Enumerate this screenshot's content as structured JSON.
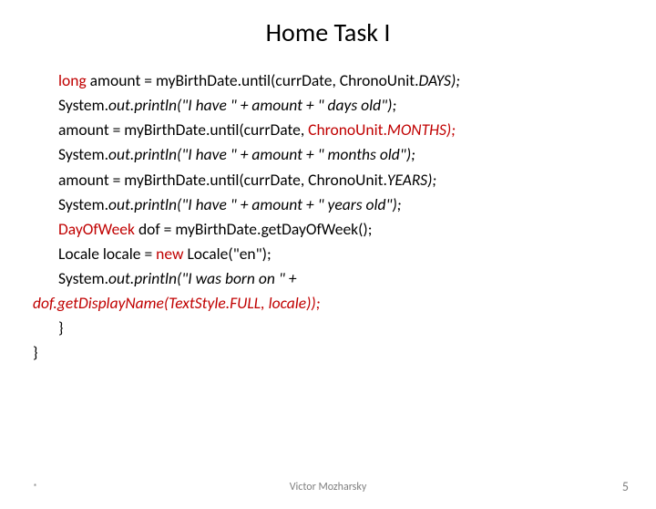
{
  "title": "Home Task I",
  "lines": [
    {
      "indent": true,
      "spans": [
        {
          "t": "long ",
          "c": "red"
        },
        {
          "t": "amount = myBirthDate.until(currDate, ",
          "c": "black"
        },
        {
          "t": "ChronoUnit.",
          "c": "black"
        },
        {
          "t": "DAYS);",
          "c": "black",
          "i": true
        }
      ]
    },
    {
      "indent": true,
      "spans": [
        {
          "t": "System.",
          "c": "black"
        },
        {
          "t": "out.println(\"I have \" + amount + \" days old\");",
          "c": "black",
          "i": true
        }
      ]
    },
    {
      "indent": true,
      "spans": [
        {
          "t": "amount = myBirthDate.until(currDate, ",
          "c": "black"
        },
        {
          "t": "ChronoUnit.",
          "c": "red"
        },
        {
          "t": "MONTHS);",
          "c": "red",
          "i": true
        }
      ]
    },
    {
      "indent": true,
      "spans": [
        {
          "t": "System.",
          "c": "black"
        },
        {
          "t": "out.println(\"I have \" + amount + \" months old\");",
          "c": "black",
          "i": true
        }
      ]
    },
    {
      "indent": true,
      "spans": [
        {
          "t": "amount = myBirthDate.until(currDate, ",
          "c": "black"
        },
        {
          "t": "ChronoUnit.",
          "c": "black"
        },
        {
          "t": "YEARS);",
          "c": "black",
          "i": true
        }
      ]
    },
    {
      "indent": true,
      "spans": [
        {
          "t": "System.",
          "c": "black"
        },
        {
          "t": "out.println(\"I have \" + amount + \" years old\");",
          "c": "black",
          "i": true
        }
      ]
    },
    {
      "indent": true,
      "spans": [
        {
          "t": "DayOfWeek ",
          "c": "red"
        },
        {
          "t": "dof = myBirthDate.getDayOfWeek();",
          "c": "black"
        }
      ]
    },
    {
      "indent": true,
      "spans": [
        {
          "t": "Locale locale = ",
          "c": "black"
        },
        {
          "t": "new ",
          "c": "red"
        },
        {
          "t": "Locale(",
          "c": "black"
        },
        {
          "t": "\"en\");",
          "c": "black"
        }
      ]
    },
    {
      "indent": true,
      "spans": [
        {
          "t": "System.",
          "c": "black"
        },
        {
          "t": "out.println(\"I was born on \" + ",
          "c": "black",
          "i": true
        }
      ]
    },
    {
      "indent": false,
      "spans": [
        {
          "t": "dof.getDisplayName(TextStyle.",
          "c": "red",
          "i": true
        },
        {
          "t": "FULL, locale));",
          "c": "red",
          "i": true
        }
      ]
    },
    {
      "indent": true,
      "spans": [
        {
          "t": "}",
          "c": "black"
        }
      ]
    },
    {
      "indent": false,
      "spans": [
        {
          "t": "}",
          "c": "black"
        }
      ]
    }
  ],
  "footer": {
    "left": "*",
    "center": "Victor Mozharsky",
    "right": "5"
  }
}
